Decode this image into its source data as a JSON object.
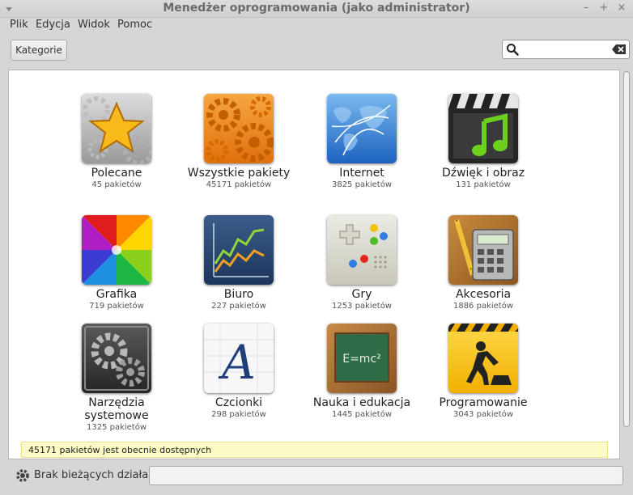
{
  "window": {
    "title": "Menedżer oprogramowania (jako administrator)"
  },
  "menubar": {
    "file": "Plik",
    "edit": "Edycja",
    "view": "Widok",
    "help": "Pomoc"
  },
  "toolbar": {
    "categories_label": "Kategorie",
    "search_value": ""
  },
  "categories": [
    {
      "name": "Polecane",
      "count": "45 pakietów",
      "icon": "star-icon"
    },
    {
      "name": "Wszystkie pakiety",
      "count": "45171 pakietów",
      "icon": "gears-icon"
    },
    {
      "name": "Internet",
      "count": "3825 pakietów",
      "icon": "globe-icon"
    },
    {
      "name": "Dźwięk i obraz",
      "count": "131 pakietów",
      "icon": "clapper-music-icon"
    },
    {
      "name": "Grafika",
      "count": "719 pakietów",
      "icon": "color-wheel-icon"
    },
    {
      "name": "Biuro",
      "count": "227 pakietów",
      "icon": "chart-icon"
    },
    {
      "name": "Gry",
      "count": "1253 pakietów",
      "icon": "gamepad-icon"
    },
    {
      "name": "Akcesoria",
      "count": "1886 pakietów",
      "icon": "calculator-icon"
    },
    {
      "name": "Narzędzia systemowe",
      "count": "1325 pakietów",
      "icon": "system-gears-icon"
    },
    {
      "name": "Czcionki",
      "count": "298 pakietów",
      "icon": "font-icon"
    },
    {
      "name": "Nauka i edukacja",
      "count": "1445 pakietów",
      "icon": "chalkboard-icon"
    },
    {
      "name": "Programowanie",
      "count": "3043 pakietów",
      "icon": "construction-icon"
    }
  ],
  "icon_text": {
    "chalkboard": "E=mc²"
  },
  "status": {
    "packages_available": "45171 pakietów jest obecnie dostępnych"
  },
  "bottom": {
    "activity_label": "Brak bieżących działań"
  }
}
